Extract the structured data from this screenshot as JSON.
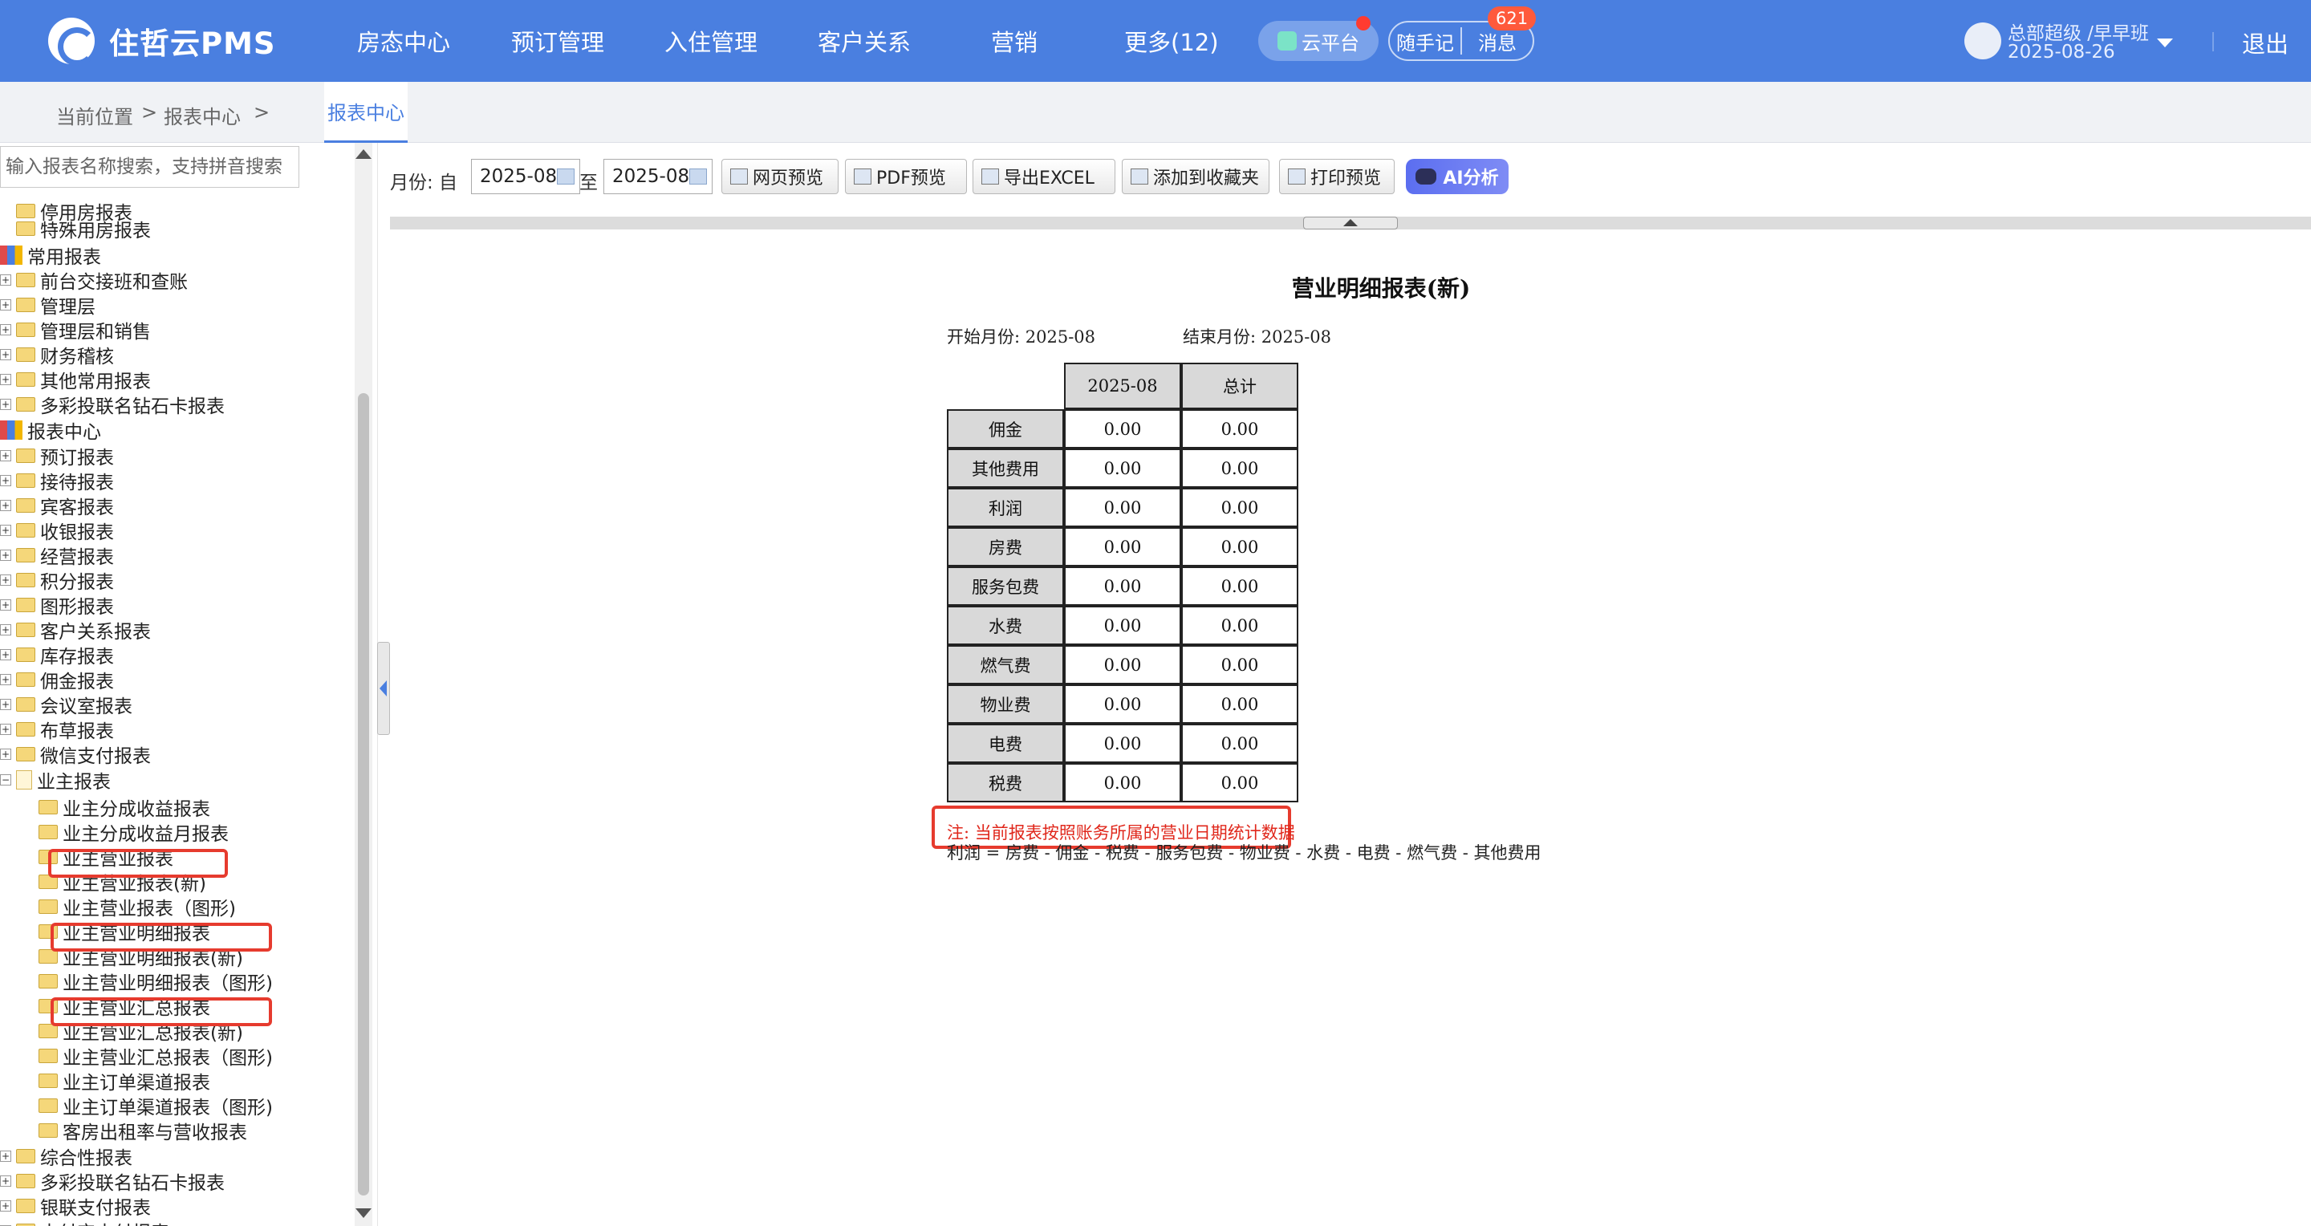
{
  "app": {
    "logo_text": "住哲云PMS"
  },
  "nav": {
    "items": [
      "房态中心",
      "预订管理",
      "入住管理",
      "客户关系",
      "营销",
      "更多(12)"
    ],
    "cloud_label": "云平台",
    "notes_label": "随手记",
    "messages_label": "消息",
    "messages_badge": "621",
    "user_name": "总部超级 /早早班",
    "user_date": "2025-08-26",
    "logout_label": "退出"
  },
  "breadcrumb": {
    "current_label": "当前位置",
    "sep": ">",
    "path": "报表中心",
    "active_tab": "报表中心"
  },
  "sidebar": {
    "search_placeholder": "输入报表名称搜索，支持拼音搜索",
    "tree": [
      "停用房报表",
      "特殊用房报表",
      "常用报表",
      "前台交接班和查账",
      "管理层",
      "管理层和销售",
      "财务稽核",
      "其他常用报表",
      "多彩投联名钻石卡报表",
      "报表中心",
      "预订报表",
      "接待报表",
      "宾客报表",
      "收银报表",
      "经营报表",
      "积分报表",
      "图形报表",
      "客户关系报表",
      "库存报表",
      "佣金报表",
      "会议室报表",
      "布草报表",
      "微信支付报表",
      "业主报表",
      "业主分成收益报表",
      "业主分成收益月报表",
      "业主营业报表",
      "业主营业报表(新)",
      "业主营业报表（图形)",
      "业主营业明细报表",
      "业主营业明细报表(新)",
      "业主营业明细报表（图形)",
      "业主营业汇总报表",
      "业主营业汇总报表(新)",
      "业主营业汇总报表（图形)",
      "业主订单渠道报表",
      "业主订单渠道报表（图形)",
      "客房出租率与营收报表",
      "综合性报表",
      "多彩投联名钻石卡报表",
      "银联支付报表",
      "支付宝支付报表"
    ]
  },
  "toolbar": {
    "month_label": "月份: 自",
    "from_value": "2025-08",
    "to_label": "至",
    "to_value": "2025-08",
    "buttons": [
      "网页预览",
      "PDF预览",
      "导出EXCEL",
      "添加到收藏夹",
      "打印预览"
    ],
    "ai_label": "AI分析"
  },
  "report": {
    "title": "营业明细报表(新)",
    "start_month": "开始月份: 2025-08",
    "end_month": "结束月份: 2025-08",
    "columns": [
      "2025-08",
      "总计"
    ],
    "rows": [
      {
        "label": "佣金",
        "values": [
          "0.00",
          "0.00"
        ]
      },
      {
        "label": "其他费用",
        "values": [
          "0.00",
          "0.00"
        ]
      },
      {
        "label": "利润",
        "values": [
          "0.00",
          "0.00"
        ]
      },
      {
        "label": "房费",
        "values": [
          "0.00",
          "0.00"
        ]
      },
      {
        "label": "服务包费",
        "values": [
          "0.00",
          "0.00"
        ]
      },
      {
        "label": "水费",
        "values": [
          "0.00",
          "0.00"
        ]
      },
      {
        "label": "燃气费",
        "values": [
          "0.00",
          "0.00"
        ]
      },
      {
        "label": "物业费",
        "values": [
          "0.00",
          "0.00"
        ]
      },
      {
        "label": "电费",
        "values": [
          "0.00",
          "0.00"
        ]
      },
      {
        "label": "税费",
        "values": [
          "0.00",
          "0.00"
        ]
      }
    ],
    "note": "注: 当前报表按照账务所属的营业日期统计数据",
    "formula": "利润 = 房费 - 佣金 - 税费 - 服务包费 - 物业费 - 水费 - 电费 - 燃气费 - 其他费用"
  },
  "colors": {
    "brand": "#4a7fe0",
    "highlight": "#e63b2e",
    "note_text": "#e0271b"
  }
}
